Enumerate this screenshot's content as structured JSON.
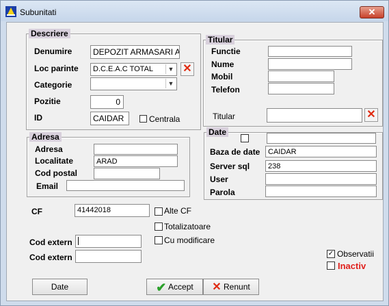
{
  "window": {
    "title": "Subunitati",
    "close_glyph": "✕"
  },
  "descriere": {
    "legend": "Descriere",
    "denumire_label": "Denumire",
    "denumire_value": "DEPOZIT ARMASARI AR",
    "loc_parinte_label": "Loc parinte",
    "loc_parinte_value": "D.C.E.A.C TOTAL",
    "categorie_label": "Categorie",
    "categorie_value": "",
    "pozitie_label": "Pozitie",
    "pozitie_value": "0",
    "id_label": "ID",
    "id_value": "CAIDAR",
    "centrala_label": "Centrala"
  },
  "titular": {
    "legend": "Titular",
    "functie_label": "Functie",
    "nume_label": "Nume",
    "mobil_label": "Mobil",
    "telefon_label": "Telefon",
    "titular_label": "Titular"
  },
  "adresa": {
    "legend": "Adresa",
    "adresa_label": "Adresa",
    "adresa_value": "",
    "localitate_label": "Localitate",
    "localitate_value": "ARAD",
    "cod_postal_label": "Cod postal",
    "cod_postal_value": "",
    "email_label": "Email",
    "email_value": ""
  },
  "date_group": {
    "legend": "Date",
    "baza_label": "Baza de date",
    "baza_value": "CAIDAR",
    "server_label": "Server sql",
    "server_value": "238",
    "user_label": "User",
    "user_value": "",
    "parola_label": "Parola",
    "parola_value": ""
  },
  "misc": {
    "cf_label": "CF",
    "cf_value": "41442018",
    "alte_cf_label": "Alte CF",
    "totalizatoare_label": "Totalizatoare",
    "cu_modificare_label": "Cu modificare",
    "cod_extern_label_1": "Cod extern",
    "cod_extern_label_2": "Cod extern",
    "observatii_label": "Observatii",
    "inactiv_label": "Inactiv",
    "check_glyph": "✓",
    "x_glyph": "✕"
  },
  "buttons": {
    "date_label": "Date",
    "accept_label": "Accept",
    "renunt_label": "Renunt"
  },
  "colors": {
    "inactiv": "#e0201c",
    "accept_icon": "#2aa02a",
    "renunt_icon": "#e02a10"
  }
}
